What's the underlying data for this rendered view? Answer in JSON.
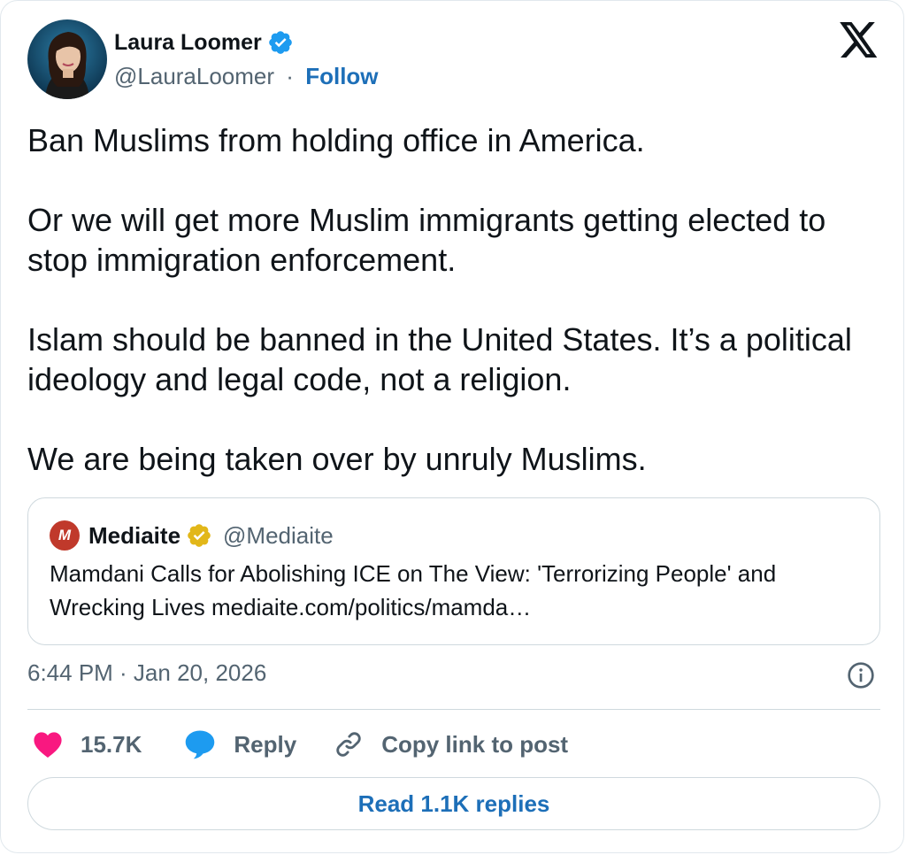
{
  "author": {
    "name": "Laura Loomer",
    "handle": "@LauraLoomer",
    "separator": "·",
    "follow_label": "Follow"
  },
  "tweet": {
    "paragraphs": [
      "Ban Muslims from holding office in America.",
      "Or we will get more Muslim immigrants getting elected to stop immigration enforcement.",
      "Islam should be banned in the United States. It’s a political ideology and legal code, not a religion.",
      "We are being taken over by unruly Muslims."
    ]
  },
  "quote": {
    "logo_letter": "M",
    "name": "Mediaite",
    "handle": "@Mediaite",
    "text": "Mamdani Calls for Abolishing ICE on The View: 'Terrorizing People' and Wrecking Lives  mediaite.com/politics/mamda…"
  },
  "meta": {
    "timestamp": "6:44 PM · Jan 20, 2026"
  },
  "actions": {
    "like_count": "15.7K",
    "reply_label": "Reply",
    "copy_label": "Copy link to post"
  },
  "read_replies_label": "Read 1.1K replies",
  "colors": {
    "accent": "#1d6fb8",
    "like": "#f91880",
    "reply_icon": "#1d9bf0",
    "verified_blue": "#1d9bf0",
    "verified_gold": "#e2b719",
    "quote_logo": "#c0392b",
    "muted": "#536471",
    "border": "#cfd9de"
  },
  "icons": [
    "verified-badge-icon",
    "x-logo-icon",
    "info-icon",
    "heart-icon",
    "reply-bubble-icon",
    "link-icon"
  ]
}
